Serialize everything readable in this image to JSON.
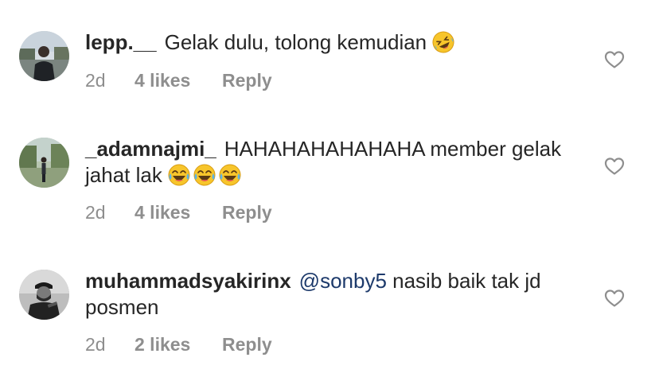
{
  "comments": [
    {
      "username": "lepp.__",
      "mention": "",
      "text": "Gelak dulu, tolong kemudian",
      "emojis": [
        "rolling-on-floor-laughing-emoji"
      ],
      "time": "2d",
      "likes": "4 likes",
      "reply": "Reply",
      "avatar": "avatar-photo-lepp"
    },
    {
      "username": "_adamnajmi_",
      "mention": "",
      "text": "HAHAHAHAHAHAHA member gelak jahat lak",
      "emojis": [
        "tears-of-joy-emoji",
        "tears-of-joy-emoji",
        "tears-of-joy-emoji"
      ],
      "time": "2d",
      "likes": "4 likes",
      "reply": "Reply",
      "avatar": "avatar-photo-adamnajmi"
    },
    {
      "username": "muhammadsyakirinx",
      "mention": "@sonby5",
      "text": "nasib baik tak jd posmen",
      "emojis": [],
      "time": "2d",
      "likes": "2 likes",
      "reply": "Reply",
      "avatar": "avatar-photo-muhammadsyakirinx"
    }
  ],
  "icons": {
    "like": "heart-outline-icon"
  },
  "colors": {
    "text": "#262626",
    "meta": "#8e8e8e",
    "mention": "#1d3a6b",
    "emoji_face": "#f7c52b"
  }
}
